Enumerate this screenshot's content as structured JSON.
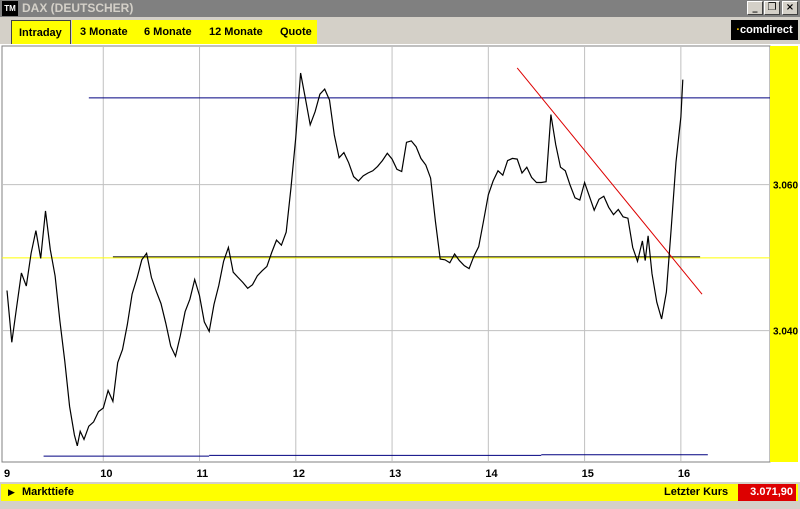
{
  "window": {
    "icon_text": "TM",
    "title": "DAX (DEUTSCHER)"
  },
  "tabs": [
    {
      "label": "Intraday",
      "active": true
    },
    {
      "label": "3 Monate",
      "active": false
    },
    {
      "label": "6 Monate",
      "active": false
    },
    {
      "label": "12 Monate",
      "active": false
    },
    {
      "label": "Quote",
      "active": false
    }
  ],
  "brand": "comdirect",
  "footer": {
    "market_depth": "Markttiefe",
    "last_price_label": "Letzter Kurs",
    "last_price_value": "3.071,90"
  },
  "colors": {
    "accent_yellow": "#ffff00",
    "price_line": "#000000",
    "horizontal_lines": "#000080",
    "support_line": "#ffff00",
    "trend_line": "#dd0000",
    "last_price_bg": "#dd0000"
  },
  "chart_data": {
    "type": "line",
    "title": "",
    "xlabel": "",
    "ylabel": "",
    "x_ticks": [
      "9",
      "10",
      "11",
      "12",
      "13",
      "14",
      "15",
      "16"
    ],
    "y_ticks": [
      "3.060",
      "3.040"
    ],
    "x_range": [
      9,
      16.9
    ],
    "y_range": [
      3022,
      3079
    ],
    "grid": true,
    "series": [
      {
        "values_x": [
          9.0,
          9.05,
          9.1,
          9.15,
          9.2,
          9.25,
          9.3,
          9.35,
          9.4,
          9.45,
          9.5,
          9.55,
          9.6,
          9.65,
          9.7,
          9.73,
          9.76,
          9.8,
          9.85,
          9.9,
          9.95,
          10.0,
          10.05,
          10.1,
          10.15,
          10.2,
          10.25,
          10.3,
          10.35,
          10.4,
          10.45,
          10.5,
          10.55,
          10.6,
          10.65,
          10.7,
          10.75,
          10.8,
          10.85,
          10.9,
          10.95,
          11.0,
          11.05,
          11.1,
          11.15,
          11.2,
          11.25,
          11.3,
          11.35,
          11.4,
          11.45,
          11.5,
          11.55,
          11.6,
          11.65,
          11.7,
          11.75,
          11.8,
          11.85,
          11.9,
          11.95,
          12.0,
          12.05,
          12.1,
          12.15,
          12.2,
          12.25,
          12.3,
          12.35,
          12.4,
          12.45,
          12.5,
          12.55,
          12.6,
          12.65,
          12.7,
          12.75,
          12.8,
          12.85,
          12.9,
          12.95,
          13.0,
          13.05,
          13.1,
          13.15,
          13.2,
          13.25,
          13.3,
          13.35,
          13.4,
          13.45,
          13.5,
          13.55,
          13.6,
          13.65,
          13.7,
          13.75,
          13.8,
          13.85,
          13.9,
          13.95,
          14.0,
          14.05,
          14.1,
          14.15,
          14.2,
          14.25,
          14.3,
          14.35,
          14.4,
          14.45,
          14.5,
          14.55,
          14.6,
          14.65,
          14.7,
          14.75,
          14.8,
          14.85,
          14.9,
          14.95,
          15.0,
          15.05,
          15.1,
          15.15,
          15.2,
          15.25,
          15.3,
          15.35,
          15.4,
          15.45,
          15.5,
          15.55,
          15.6,
          15.63,
          15.66,
          15.7,
          15.75,
          15.8,
          15.85,
          15.9,
          15.95,
          16.0,
          16.02
        ],
        "values_y": [
          3045.5,
          3038.4,
          3043.2,
          3047.9,
          3046.1,
          3050.6,
          3053.7,
          3049.9,
          3056.4,
          3051.1,
          3047.5,
          3041.3,
          3035.8,
          3029.6,
          3025.7,
          3024.2,
          3026.2,
          3025.1,
          3026.9,
          3027.5,
          3028.9,
          3029.4,
          3031.8,
          3030.3,
          3035.6,
          3037.4,
          3040.8,
          3045.0,
          3047.2,
          3049.7,
          3050.6,
          3047.3,
          3045.4,
          3043.7,
          3041.0,
          3037.9,
          3036.5,
          3039.3,
          3042.6,
          3044.3,
          3047.0,
          3044.8,
          3041.2,
          3039.9,
          3043.6,
          3046.2,
          3049.5,
          3051.4,
          3048.0,
          3047.3,
          3046.6,
          3045.8,
          3046.3,
          3047.5,
          3048.2,
          3048.8,
          3050.7,
          3052.4,
          3051.7,
          3053.5,
          3059.6,
          3066.5,
          3075.3,
          3071.8,
          3068.2,
          3070.0,
          3072.4,
          3073.1,
          3071.6,
          3066.8,
          3063.7,
          3064.4,
          3063.0,
          3061.1,
          3060.5,
          3061.2,
          3061.6,
          3061.9,
          3062.5,
          3063.3,
          3064.3,
          3063.5,
          3062.1,
          3061.8,
          3065.8,
          3066.0,
          3065.2,
          3063.6,
          3062.7,
          3060.9,
          3055.0,
          3049.8,
          3049.7,
          3049.3,
          3050.5,
          3049.6,
          3048.9,
          3048.5,
          3050.2,
          3051.5,
          3055.0,
          3058.6,
          3060.5,
          3061.9,
          3061.3,
          3063.3,
          3063.6,
          3063.5,
          3061.6,
          3062.4,
          3061.0,
          3060.3,
          3060.3,
          3060.4,
          3069.6,
          3065.5,
          3062.4,
          3061.9,
          3059.9,
          3058.2,
          3057.9,
          3060.3,
          3058.4,
          3056.5,
          3058.0,
          3058.4,
          3056.9,
          3055.9,
          3056.6,
          3055.6,
          3055.4,
          3051.4,
          3049.5,
          3052.3,
          3049.6,
          3053.0,
          3047.8,
          3043.9,
          3041.6,
          3045.3,
          3054.0,
          3063.1,
          3069.3,
          3074.4,
          3073.8,
          3071.9
        ]
      }
    ]
  }
}
